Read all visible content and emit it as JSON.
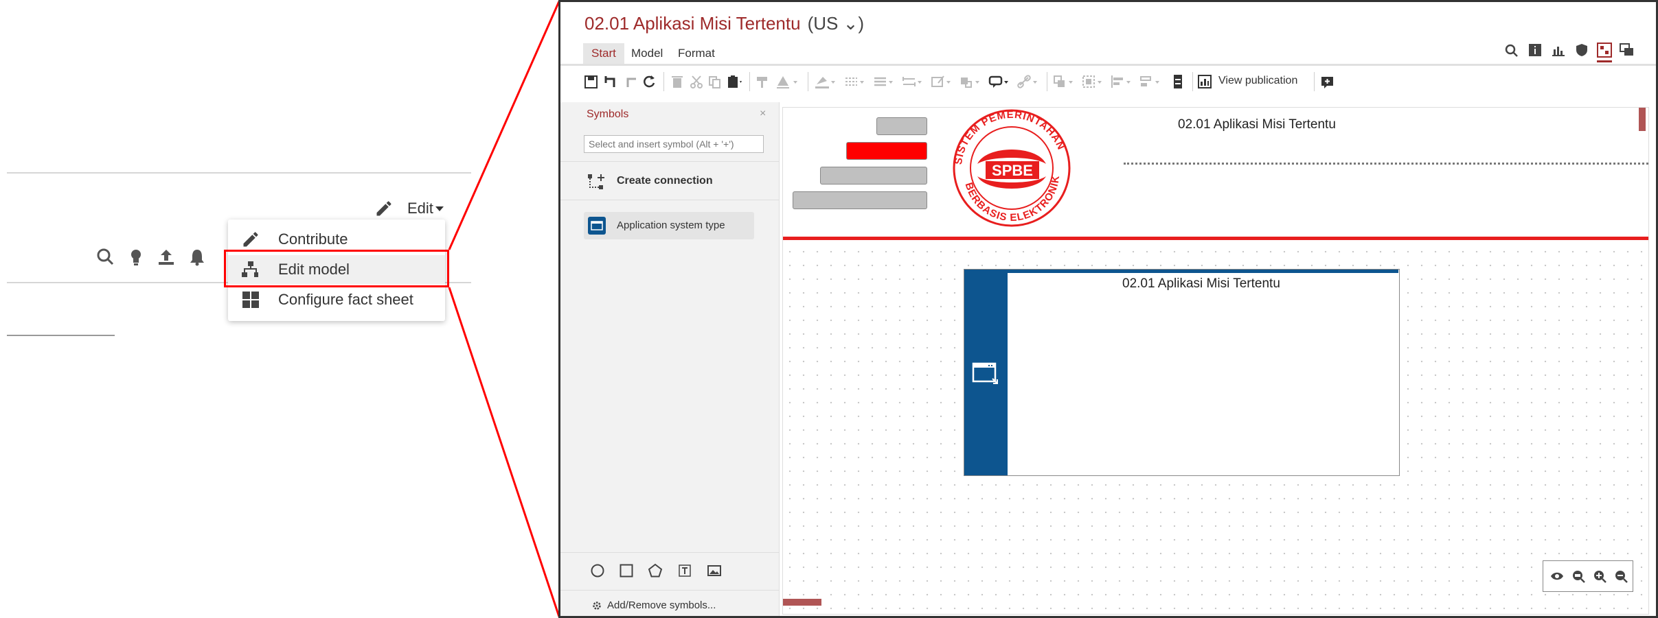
{
  "left_panel": {
    "edit_label": "Edit",
    "menu_items": [
      {
        "label": "Contribute",
        "icon": "pencil-icon"
      },
      {
        "label": "Edit model",
        "icon": "edit-model-icon"
      },
      {
        "label": "Configure fact sheet",
        "icon": "grid-icon"
      }
    ],
    "toolbar_icons": [
      "search-icon",
      "lightbulb-icon",
      "upload-icon",
      "bell-icon"
    ]
  },
  "window": {
    "title": "02.01 Aplikasi Misi Tertentu",
    "language": "(US ⌄)",
    "tabs": [
      "Start",
      "Model",
      "Format"
    ],
    "active_tab": "Start",
    "view_publication_label": "View publication",
    "header_right_icons": [
      "search-icon",
      "info-icon",
      "chart-icon",
      "shield-icon",
      "diagram-icon",
      "windows-icon"
    ]
  },
  "symbols_panel": {
    "title": "Symbols",
    "close": "×",
    "search_placeholder": "Select and insert symbol (Alt + '+')",
    "create_connection_label": "Create connection",
    "symbol_items": [
      "Application system type"
    ],
    "add_remove_label": "Add/Remove symbols..."
  },
  "canvas": {
    "header_title": "02.01 Aplikasi Misi Tertentu",
    "logo_ring_text": "SISTEM PEMERINTAHAN BERBASIS ELEKTRONIK",
    "logo_center_text": "SPBE",
    "box_title": "02.01 Aplikasi Misi Tertentu"
  },
  "colors": {
    "accent_red": "#e81e1e",
    "title_red": "#9e2a2a",
    "box_blue": "#0d558f",
    "highlight_red": "#ff0000"
  }
}
